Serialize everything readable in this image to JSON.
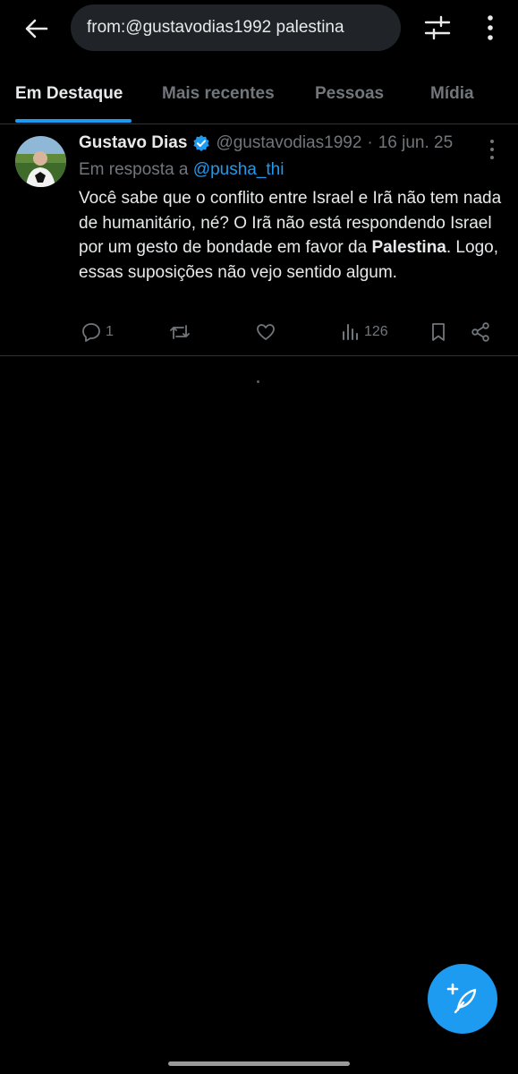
{
  "search": {
    "query": "from:@gustavodias1992 palestina"
  },
  "tabs": [
    {
      "label": "Em Destaque",
      "active": true
    },
    {
      "label": "Mais recentes",
      "active": false
    },
    {
      "label": "Pessoas",
      "active": false
    },
    {
      "label": "Mídia",
      "active": false
    }
  ],
  "tweet": {
    "author_name": "Gustavo Dias",
    "verified": true,
    "handle": "@gustavodias1992",
    "separator": "·",
    "date": "16 jun. 25",
    "reply_prefix": "Em resposta a",
    "reply_handle": "@pusha_thi",
    "text_before": "Você sabe que o conflito entre Israel e Irã não tem nada de humanitário, né? O Irã não está respondendo Israel por um gesto de bondade em favor da ",
    "text_bold": "Palestina",
    "text_after": ". Logo, essas suposições não vejo sentido algum.",
    "replies": "1",
    "views": "126"
  },
  "colors": {
    "accent": "#1d9bf0",
    "muted": "#71767b",
    "text": "#e7e9ea",
    "background": "#000000"
  },
  "icons": [
    "back-arrow-icon",
    "filter-sliders-icon",
    "more-vertical-icon",
    "verified-badge-icon",
    "reply-icon",
    "retweet-icon",
    "like-icon",
    "views-icon",
    "bookmark-icon",
    "share-icon",
    "compose-icon"
  ]
}
